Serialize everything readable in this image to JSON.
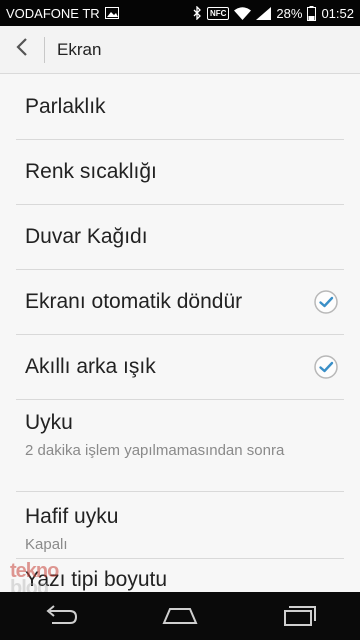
{
  "status_bar": {
    "carrier": "VODAFONE TR",
    "battery": "28%",
    "time": "01:52",
    "nfc": "NFC",
    "icons": [
      "image-icon",
      "bluetooth-icon",
      "nfc-icon",
      "wifi-icon",
      "signal-icon",
      "battery-icon"
    ]
  },
  "app_bar": {
    "title": "Ekran",
    "back_icon": "chevron-left-icon"
  },
  "settings": {
    "items": [
      {
        "title": "Parlaklık"
      },
      {
        "title": "Renk sıcaklığı"
      },
      {
        "title": "Duvar Kağıdı"
      },
      {
        "title": "Ekranı otomatik döndür",
        "checked": true
      },
      {
        "title": "Akıllı arka ışık",
        "checked": true
      },
      {
        "title": "Uyku",
        "subtitle": "2 dakika işlem yapılmamasından sonra"
      },
      {
        "title": "Hafif uyku",
        "subtitle": "Kapalı"
      },
      {
        "title": "Yazı tipi boyutu"
      }
    ]
  },
  "nav_bar": {
    "icons": [
      "back-nav-icon",
      "home-nav-icon",
      "recents-nav-icon"
    ]
  },
  "watermark": {
    "top": "tekno",
    "bottom": "blog"
  },
  "colors": {
    "accent": "#3a8fc7",
    "status_bar": "#050505",
    "nav_bar": "#0a0a0a"
  }
}
